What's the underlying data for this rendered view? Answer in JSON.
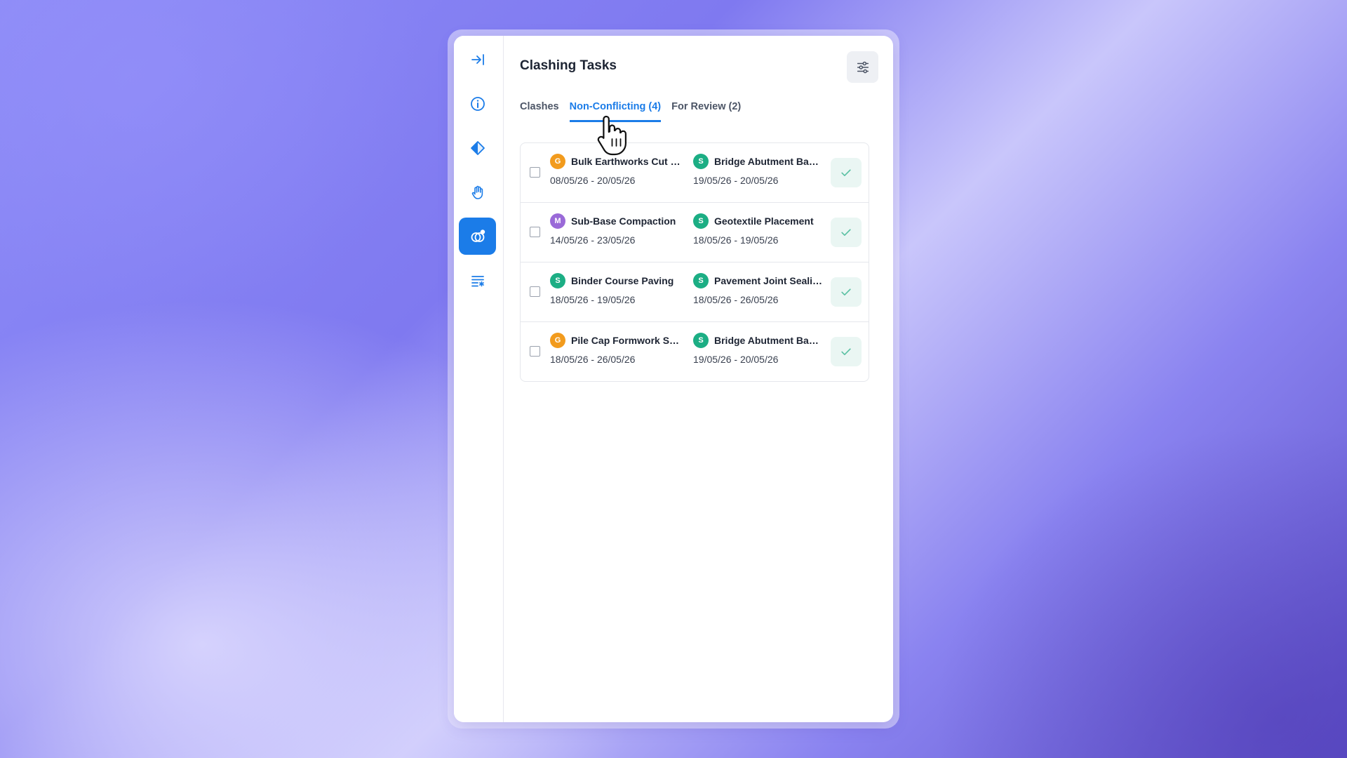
{
  "panel": {
    "title": "Clashing Tasks",
    "filter_icon": "sliders-icon"
  },
  "rail": {
    "items": [
      {
        "name": "collapse-panel",
        "icon": "arrow-to-right-icon",
        "active": false
      },
      {
        "name": "info",
        "icon": "info-icon",
        "active": false
      },
      {
        "name": "milestone",
        "icon": "diamond-icon",
        "active": false
      },
      {
        "name": "hold",
        "icon": "hand-icon",
        "active": false
      },
      {
        "name": "clashes",
        "icon": "overlap-circles-icon",
        "active": true
      },
      {
        "name": "task-list",
        "icon": "list-asterisk-icon",
        "active": false
      }
    ]
  },
  "tabs": [
    {
      "label": "Clashes",
      "active": false
    },
    {
      "label": "Non-Conflicting (4)",
      "active": true
    },
    {
      "label": "For Review (2)",
      "active": false
    }
  ],
  "rows": [
    {
      "a": {
        "badge": "G",
        "badge_color": "#f29b1d",
        "name": "Bulk Earthworks Cut …",
        "dates": "08/05/26 - 20/05/26"
      },
      "b": {
        "badge": "S",
        "badge_color": "#1cae84",
        "name": "Bridge Abutment Ba…",
        "dates": "19/05/26 - 20/05/26"
      }
    },
    {
      "a": {
        "badge": "M",
        "badge_color": "#9a6ad8",
        "name": "Sub-Base Compaction",
        "dates": "14/05/26 - 23/05/26"
      },
      "b": {
        "badge": "S",
        "badge_color": "#1cae84",
        "name": "Geotextile Placement",
        "dates": "18/05/26 - 19/05/26"
      }
    },
    {
      "a": {
        "badge": "S",
        "badge_color": "#1cae84",
        "name": "Binder Course Paving",
        "dates": "18/05/26 - 19/05/26"
      },
      "b": {
        "badge": "S",
        "badge_color": "#1cae84",
        "name": "Pavement Joint Seali…",
        "dates": "18/05/26 - 26/05/26"
      }
    },
    {
      "a": {
        "badge": "G",
        "badge_color": "#f29b1d",
        "name": "Pile Cap Formwork S…",
        "dates": "18/05/26 - 26/05/26"
      },
      "b": {
        "badge": "S",
        "badge_color": "#1cae84",
        "name": "Bridge Abutment Ba…",
        "dates": "19/05/26 - 20/05/26"
      }
    }
  ],
  "colors": {
    "accent": "#1b7ce8",
    "approve_check": "#5cc1a4"
  }
}
